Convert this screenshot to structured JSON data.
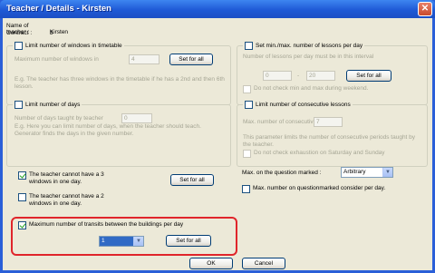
{
  "window": {
    "title": "Teacher / Details - Kirsten",
    "close_glyph": "✕"
  },
  "info": {
    "name_label": "Name of teacher :",
    "name_value": "Kirsten",
    "contract_label": "Contract :",
    "contract_value": "3"
  },
  "windows_group": {
    "legend": "Limit number of windows in timetable",
    "max_label": "Maximum number of windows in",
    "max_value": "4",
    "set_all": "Set for all",
    "hint": "E.g. The teacher has three windows in the timetable if he has a 2nd and then 6th lesson."
  },
  "minmax_group": {
    "legend": "Set min./max. number of lessons per day",
    "range_label": "Number of lessons per day must be in this interval",
    "min_value": "0",
    "dash": "-",
    "max_value": "20",
    "set_all": "Set for all",
    "weekend_label": "Do not check min and max during weekend."
  },
  "days_group": {
    "legend": "Limit number of days",
    "days_label": "Number of days taught by teacher",
    "days_value": "0",
    "hint": "E.g. Here you can limit number of days, when the teacher should teach. Generator finds the days in the given number."
  },
  "consecutive_group": {
    "legend": "Limit number of consecutive lessons",
    "max_label": "Max. number of consecutive",
    "max_value": "7",
    "hint": "This parameter limits the number of consecutive periods taught by the teacher.",
    "weekend_label": "Do not check exhaustion on Saturday and Sunday"
  },
  "three_windows": {
    "label": "The teacher cannot have a 3 windows in one day.",
    "checked": true,
    "set_all": "Set for all"
  },
  "two_windows": {
    "label": "The teacher cannot have a 2 windows in one day.",
    "checked": false
  },
  "question": {
    "label": "Max. on the question marked :",
    "selected": "Arbitrary",
    "per_day_label": "Max. number on questionmarked consider per day.",
    "per_day_checked": false
  },
  "transits": {
    "label": "Maximum number of transits between the buildings per day",
    "checked": true,
    "selected": "1",
    "set_all": "Set for all"
  },
  "footer": {
    "ok": "OK",
    "cancel": "Cancel"
  },
  "colors": {
    "titlebar": "#1f5ad6",
    "dialog_bg": "#ece9d8",
    "highlight_box": "#e0252b",
    "select_highlight": "#316ac5"
  },
  "icons": {
    "dropdown": "chevron-down-icon",
    "check": "check-icon"
  }
}
